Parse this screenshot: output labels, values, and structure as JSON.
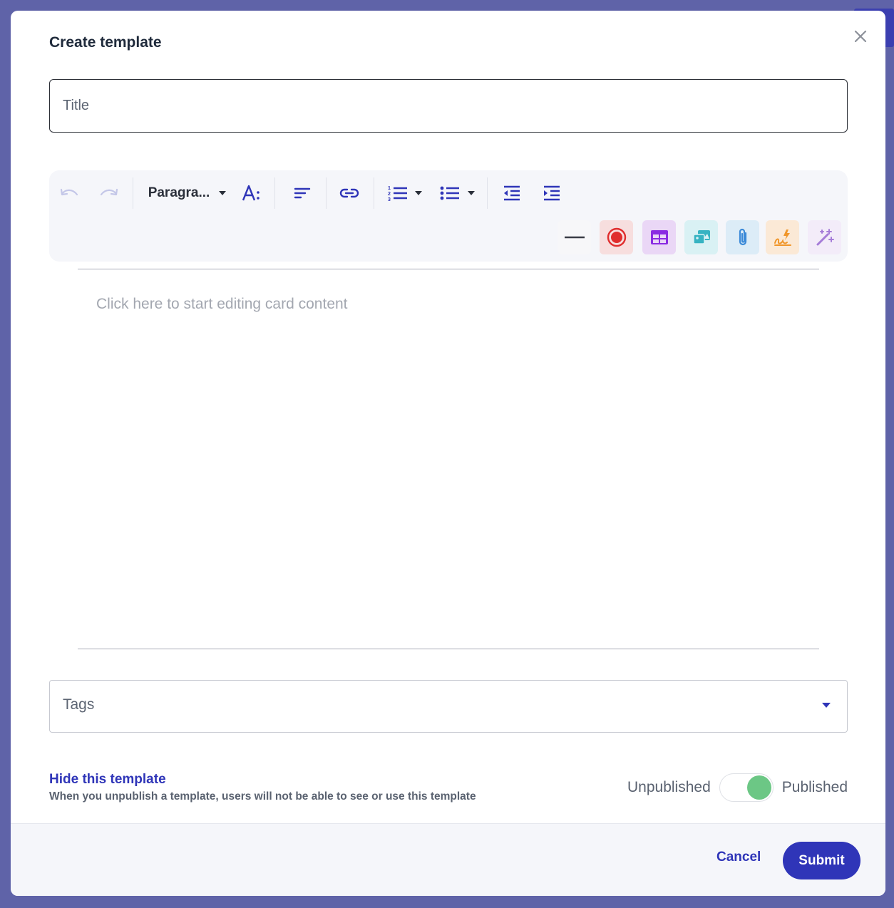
{
  "modal": {
    "title": "Create template",
    "title_placeholder": "Title"
  },
  "toolbar": {
    "block_format": "Paragra...",
    "icons": [
      "undo-icon",
      "redo-icon",
      "font-size-icon",
      "align-icon",
      "link-icon",
      "numbered-list-icon",
      "bulleted-list-icon",
      "outdent-icon",
      "indent-icon",
      "horizontal-line-icon",
      "record-icon",
      "table-icon",
      "image-gallery-icon",
      "attachment-icon",
      "signature-icon",
      "magic-wand-icon"
    ]
  },
  "editor": {
    "placeholder": "Click here to start editing card content"
  },
  "tags": {
    "label": "Tags"
  },
  "visibility": {
    "title": "Hide this template",
    "description": "When you unpublish a template, users will not be able to see or use this template",
    "off_label": "Unpublished",
    "on_label": "Published",
    "published": true
  },
  "footer": {
    "cancel_label": "Cancel",
    "submit_label": "Submit"
  },
  "colors": {
    "accent": "#2f35b8",
    "toggle_on": "#6cc785",
    "overlay": "#5f63a8"
  }
}
